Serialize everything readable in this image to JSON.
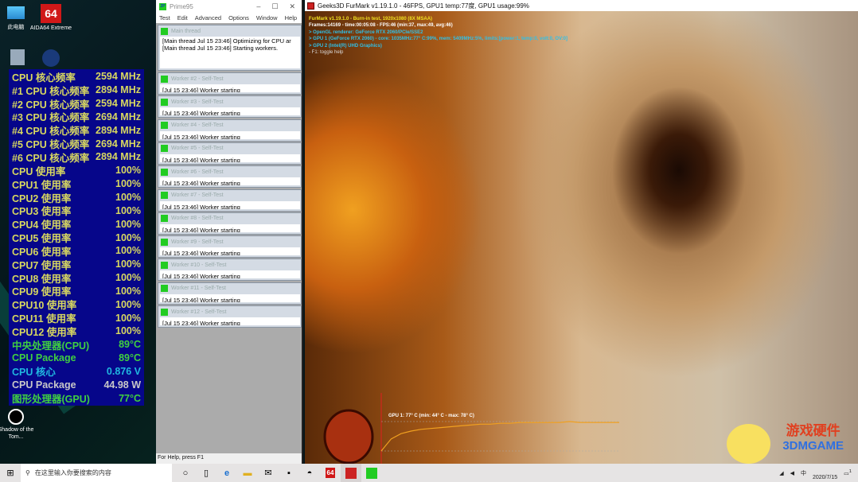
{
  "desktop": {
    "icons": [
      {
        "label": "此电脑"
      },
      {
        "label": "AIDA64 Extreme"
      },
      {
        "label": "Shadow of the Tom..."
      }
    ]
  },
  "aida": {
    "rows": [
      {
        "label": "CPU 核心频率",
        "value": "2594 MHz",
        "color": "yellow"
      },
      {
        "label": "#1 CPU 核心频率",
        "value": "2894 MHz",
        "color": "yellow"
      },
      {
        "label": "#2 CPU 核心频率",
        "value": "2594 MHz",
        "color": "yellow"
      },
      {
        "label": "#3 CPU 核心频率",
        "value": "2694 MHz",
        "color": "yellow"
      },
      {
        "label": "#4 CPU 核心频率",
        "value": "2894 MHz",
        "color": "yellow"
      },
      {
        "label": "#5 CPU 核心频率",
        "value": "2694 MHz",
        "color": "yellow"
      },
      {
        "label": "#6 CPU 核心频率",
        "value": "2894 MHz",
        "color": "yellow"
      },
      {
        "label": "CPU 使用率",
        "value": "100%",
        "color": "yellow"
      },
      {
        "label": "CPU1 使用率",
        "value": "100%",
        "color": "yellow"
      },
      {
        "label": "CPU2 使用率",
        "value": "100%",
        "color": "yellow"
      },
      {
        "label": "CPU3 使用率",
        "value": "100%",
        "color": "yellow"
      },
      {
        "label": "CPU4 使用率",
        "value": "100%",
        "color": "yellow"
      },
      {
        "label": "CPU5 使用率",
        "value": "100%",
        "color": "yellow"
      },
      {
        "label": "CPU6 使用率",
        "value": "100%",
        "color": "yellow"
      },
      {
        "label": "CPU7 使用率",
        "value": "100%",
        "color": "yellow"
      },
      {
        "label": "CPU8 使用率",
        "value": "100%",
        "color": "yellow"
      },
      {
        "label": "CPU9 使用率",
        "value": "100%",
        "color": "yellow"
      },
      {
        "label": "CPU10 使用率",
        "value": "100%",
        "color": "yellow"
      },
      {
        "label": "CPU11 使用率",
        "value": "100%",
        "color": "yellow"
      },
      {
        "label": "CPU12 使用率",
        "value": "100%",
        "color": "yellow"
      },
      {
        "label": "中央处理器(CPU)",
        "value": "89°C",
        "color": "green"
      },
      {
        "label": "CPU Package",
        "value": "89°C",
        "color": "green"
      },
      {
        "label": "CPU 核心",
        "value": "0.876 V",
        "color": "cyan"
      },
      {
        "label": "CPU Package",
        "value": "44.98 W",
        "color": "white"
      },
      {
        "label": "图形处理器(GPU)",
        "value": "77°C",
        "color": "green"
      }
    ]
  },
  "prime": {
    "title": "Prime95",
    "menu": [
      "Test",
      "Edit",
      "Advanced",
      "Options",
      "Window",
      "Help"
    ],
    "main": {
      "title": "Main thread",
      "lines": [
        "[Main thread Jul 15 23:46] Optimizing for CPU ar",
        "[Main thread Jul 15 23:46] Starting workers."
      ]
    },
    "workers": [
      {
        "title": "Worker #2 - Self-Test",
        "line": "[Jul 15 23:46] Worker starting"
      },
      {
        "title": "Worker #3 - Self-Test",
        "line": "[Jul 15 23:46] Worker starting"
      },
      {
        "title": "Worker #4 - Self-Test",
        "line": "[Jul 15 23:46] Worker starting"
      },
      {
        "title": "Worker #5 - Self-Test",
        "line": "[Jul 15 23:46] Worker starting"
      },
      {
        "title": "Worker #6 - Self-Test",
        "line": "[Jul 15 23:46] Worker starting"
      },
      {
        "title": "Worker #7 - Self-Test",
        "line": "[Jul 15 23:46] Worker starting"
      },
      {
        "title": "Worker #8 - Self-Test",
        "line": "[Jul 15 23:46] Worker starting"
      },
      {
        "title": "Worker #9 - Self-Test",
        "line": "[Jul 15 23:46] Worker starting"
      },
      {
        "title": "Worker #10 - Self-Test",
        "line": "[Jul 15 23:46] Worker starting"
      },
      {
        "title": "Worker #11 - Self-Test",
        "line": "[Jul 15 23:46] Worker starting"
      },
      {
        "title": "Worker #12 - Self-Test",
        "line": "[Jul 15 23:46] Worker starting"
      }
    ],
    "status": "For Help, press F1"
  },
  "furmark": {
    "title": "Geeks3D FurMark v1.19.1.0 - 46FPS, GPU1 temp:77度, GPU1 usage:99%",
    "hud": [
      "FurMark v1.19.1.0 - Burn-in test, 1920x1080 (8X MSAA)",
      "Frames:14169 - time:00:05:08 - FPS:46 (min:37, max:49, avg:46)",
      "> OpenGL renderer: GeForce RTX 2060/PCIe/SSE2",
      "> GPU 1 (GeForce RTX 2060) - core: 1035MHz:77° C:99%, mem: 5409MHz:5%, limits:[power:1, temp:0, volt:0, OV:0]",
      "> GPU 2 (Intel(R) UHD Graphics)",
      "- F1: toggle help"
    ],
    "graph_label": "GPU 1: 77° C (min: 44° C - max: 78° C)",
    "temp_series": [
      44,
      58,
      64,
      67,
      69,
      70,
      71,
      72,
      73,
      74,
      75,
      75,
      76,
      76,
      77,
      77,
      77,
      77,
      77,
      78,
      77,
      77,
      77,
      77,
      77
    ]
  },
  "taskbar": {
    "search_placeholder": "在这里输入你要搜索的内容",
    "date": "2020/7/15",
    "ime": "中",
    "notif_count": "1"
  },
  "watermark": {
    "line1": "游戏硬件",
    "line2": "3DMGAME"
  }
}
